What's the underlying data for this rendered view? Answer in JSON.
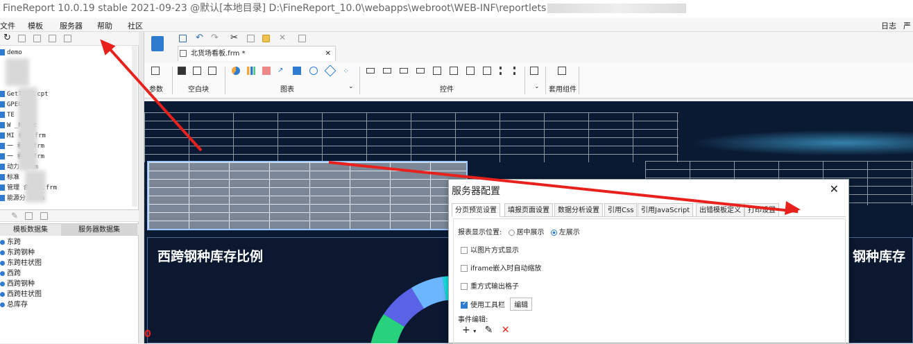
{
  "titlebar": {
    "title": "FineReport 10.0.19 stable 2021-09-23 @默认[本地目录]    D:\\FineReport_10.0\\webapps\\webroot\\WEB-INF\\reportlets"
  },
  "menu": {
    "items": [
      "文件",
      "模板",
      "服务器",
      "帮助",
      "社区"
    ],
    "right_items": [
      "日志",
      "严"
    ]
  },
  "tree": {
    "items": [
      "demo",
      "",
      "",
      "GetT      ed.cpt",
      "GPEO",
      "TE",
      "W       _N.cpt",
      "MI       看板.frm",
      "一     看板.frm",
      "一     看板.frm",
      "动力     .frm",
      "标准",
      "管理     合看板.frm",
      "能源分    .frm"
    ]
  },
  "datasets": {
    "tabs": [
      "模板数据集",
      "服务器数据集"
    ],
    "items": [
      "东跨",
      "东跨钢种",
      "东跨柱状图",
      "西跨",
      "西跨钢种",
      "西跨柱状图",
      "总库存"
    ]
  },
  "doc_tab": {
    "name": "北货场看板.frm *"
  },
  "ribbon": {
    "groups": [
      "参数",
      "空白块",
      "图表",
      "控件",
      "套用组件"
    ]
  },
  "canvas": {
    "chart_title_left": "西跨钢种库存比例",
    "chart_title_right": "钢种库存",
    "corner_marker": "0"
  },
  "dialog": {
    "title": "服务器配置",
    "close": "✕",
    "tabs": [
      "分页预览设置",
      "填报页面设置",
      "数据分析设置",
      "引用Css",
      "引用JavaScript",
      "出错模板定义",
      "打印设置"
    ],
    "display_position_label": "报表显示位置:",
    "radio_center": "居中展示",
    "radio_left": "左展示",
    "opt_image": "以图片方式显示",
    "opt_iframe": "iframe嵌入时自动缩放",
    "opt_repeat": "重方式输出格子",
    "opt_toolbar": "使用工具栏",
    "edit_button": "编辑",
    "event_label": "事件编辑:",
    "event_add": "+",
    "event_edit": "✎",
    "event_delete": "✕"
  },
  "colors": {
    "accent": "#2e7bd0",
    "arrow": "#e8211c",
    "canvas_bg": "#0a1a33"
  }
}
